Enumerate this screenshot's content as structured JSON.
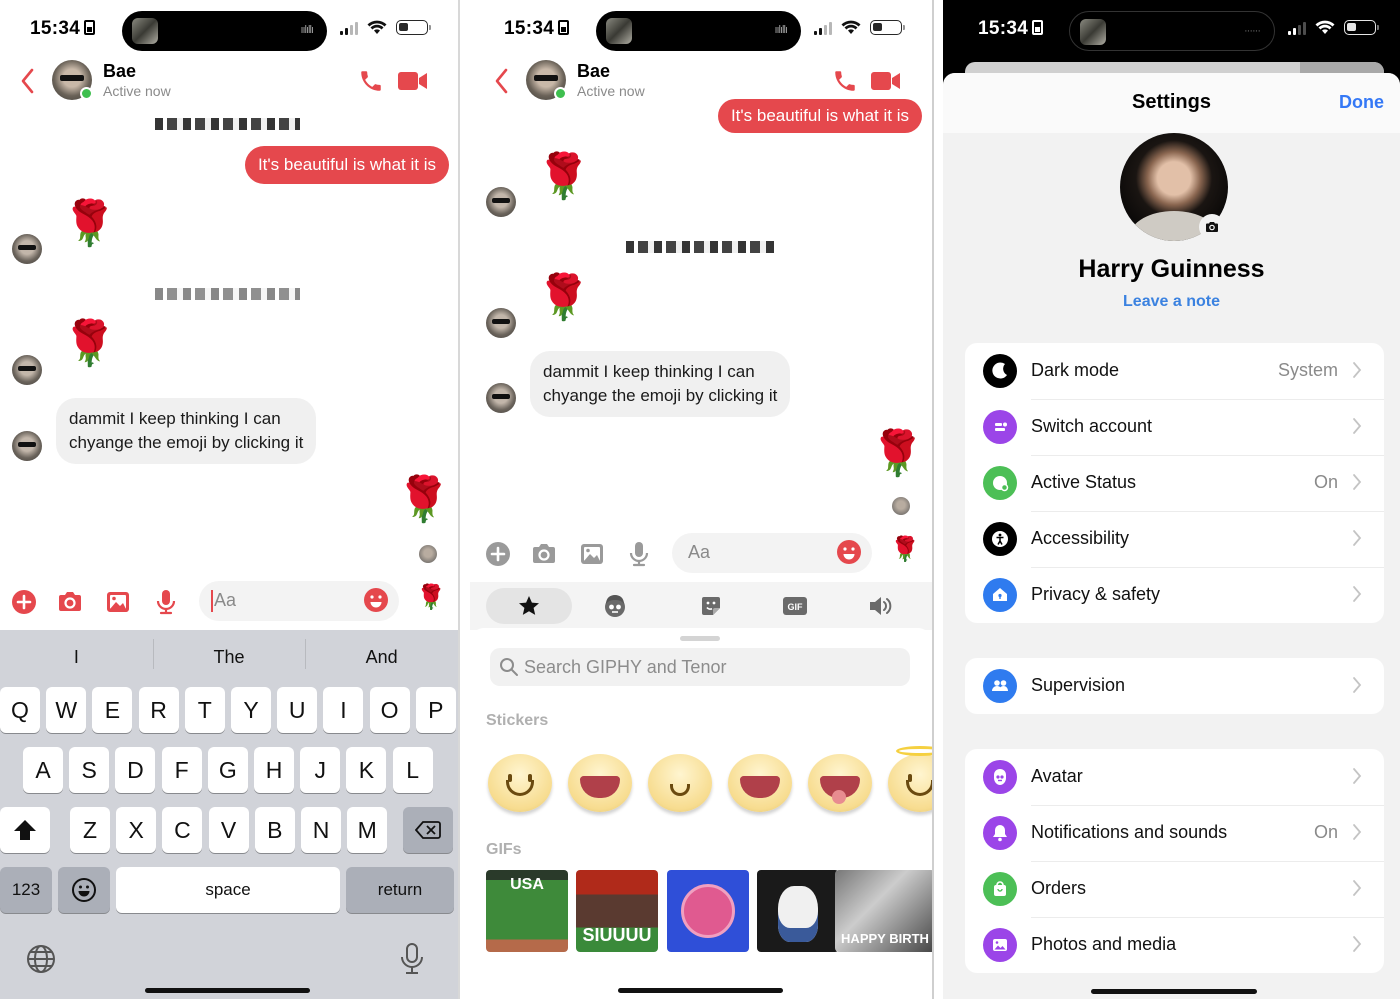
{
  "status_bar": {
    "time": "15:34"
  },
  "colors": {
    "accent_red": "#e5484d",
    "ios_blue": "#3478f6",
    "online_green": "#3fbf4f"
  },
  "chat": {
    "contact_name": "Bae",
    "contact_status": "Active now",
    "messages": {
      "outgoing_text": "It's beautiful is what it is",
      "incoming_text_line1": "dammit I keep thinking I can",
      "incoming_text_line2": "chyange the emoji by clicking it",
      "rose_emoji": "🌹"
    },
    "composer": {
      "placeholder": "Aa",
      "quick_reaction": "🌹"
    }
  },
  "keyboard": {
    "suggestions": [
      "I",
      "The",
      "And"
    ],
    "row1": [
      "Q",
      "W",
      "E",
      "R",
      "T",
      "Y",
      "U",
      "I",
      "O",
      "P"
    ],
    "row2": [
      "A",
      "S",
      "D",
      "F",
      "G",
      "H",
      "J",
      "K",
      "L"
    ],
    "row3": [
      "Z",
      "X",
      "C",
      "V",
      "B",
      "N",
      "M"
    ],
    "numbers_key": "123",
    "space_key": "space",
    "return_key": "return"
  },
  "sticker_tray": {
    "tabs": [
      "favorites",
      "avatar",
      "stickers",
      "gif",
      "sounds"
    ],
    "active_tab": "favorites",
    "search_placeholder": "Search GIPHY and Tenor",
    "stickers_label": "Stickers",
    "gifs_label": "GIFs",
    "gifs": [
      {
        "caption": "USA"
      },
      {
        "caption": "SIUUUU"
      },
      {
        "caption": ""
      },
      {
        "caption": ""
      },
      {
        "caption": "HAPPY BIRTH"
      }
    ]
  },
  "settings": {
    "title": "Settings",
    "done_label": "Done",
    "profile_name": "Harry Guinness",
    "leave_note": "Leave a note",
    "group1": [
      {
        "label": "Dark mode",
        "value": "System",
        "icon": "moon-icon",
        "color": "#000000"
      },
      {
        "label": "Switch account",
        "value": "",
        "icon": "switch-account-icon",
        "color": "#9b45e8"
      },
      {
        "label": "Active Status",
        "value": "On",
        "icon": "active-status-icon",
        "color": "#4cbf56"
      },
      {
        "label": "Accessibility",
        "value": "",
        "icon": "accessibility-icon",
        "color": "#000000"
      },
      {
        "label": "Privacy & safety",
        "value": "",
        "icon": "privacy-house-icon",
        "color": "#2f7bef"
      }
    ],
    "group2": [
      {
        "label": "Supervision",
        "value": "",
        "icon": "supervision-people-icon",
        "color": "#2f7bef"
      }
    ],
    "group3": [
      {
        "label": "Avatar",
        "value": "",
        "icon": "avatar-face-icon",
        "color": "#9b45e8"
      },
      {
        "label": "Notifications and sounds",
        "value": "On",
        "icon": "bell-icon",
        "color": "#9b45e8"
      },
      {
        "label": "Orders",
        "value": "",
        "icon": "shopping-bag-icon",
        "color": "#4cbf56"
      },
      {
        "label": "Photos and media",
        "value": "",
        "icon": "photo-icon",
        "color": "#9b45e8"
      }
    ]
  }
}
